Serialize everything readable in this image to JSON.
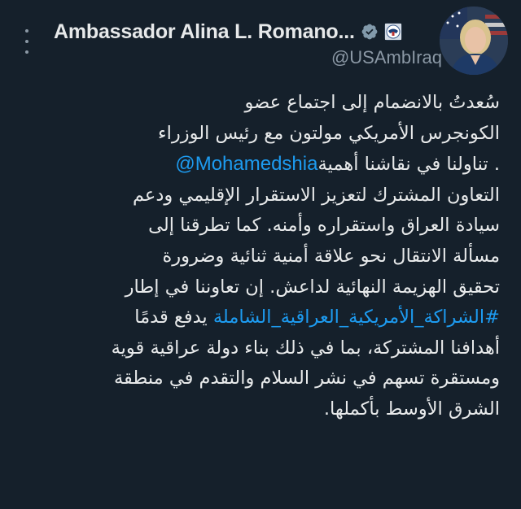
{
  "tweet": {
    "author": {
      "display_name": "Ambassador Alina L. Romano...",
      "handle": "@USAmbIraq",
      "verified_icon": "verified-badge-icon",
      "affiliation_icon": "us-embassy-seal-icon",
      "avatar": "profile-photo"
    },
    "more_icon": "more-options-icon",
    "body": {
      "line1": "سُعدتُ بالانضمام إلى اجتماع عضو",
      "line2": "الكونجرس الأمريكي مولتون مع رئيس الوزراء",
      "mention": "@Mohamedshia",
      "line3_after": " . تناولنا في نقاشنا أهمية",
      "line4": "التعاون المشترك لتعزيز الاستقرار الإقليمي ودعم",
      "line5": "سيادة العراق واستقراره وأمنه. كما تطرقنا إلى",
      "line6": "مسألة الانتقال نحو علاقة أمنية ثنائية وضرورة",
      "line7": "تحقيق الهزيمة النهائية لداعش. إن تعاوننا في إطار",
      "hashtag": "#الشراكة_الأمريكية_العراقية_الشاملة",
      "line8_after": " يدفع قدمًا",
      "line9": "أهدافنا المشتركة، بما في ذلك بناء دولة عراقية قوية",
      "line10": "ومستقرة تسهم في نشر السلام والتقدم في منطقة",
      "line11": "الشرق الأوسط بأكملها."
    },
    "colors": {
      "background": "#15202b",
      "text": "#e7e9ea",
      "secondary": "#8b98a5",
      "link": "#1d9bf0"
    }
  }
}
